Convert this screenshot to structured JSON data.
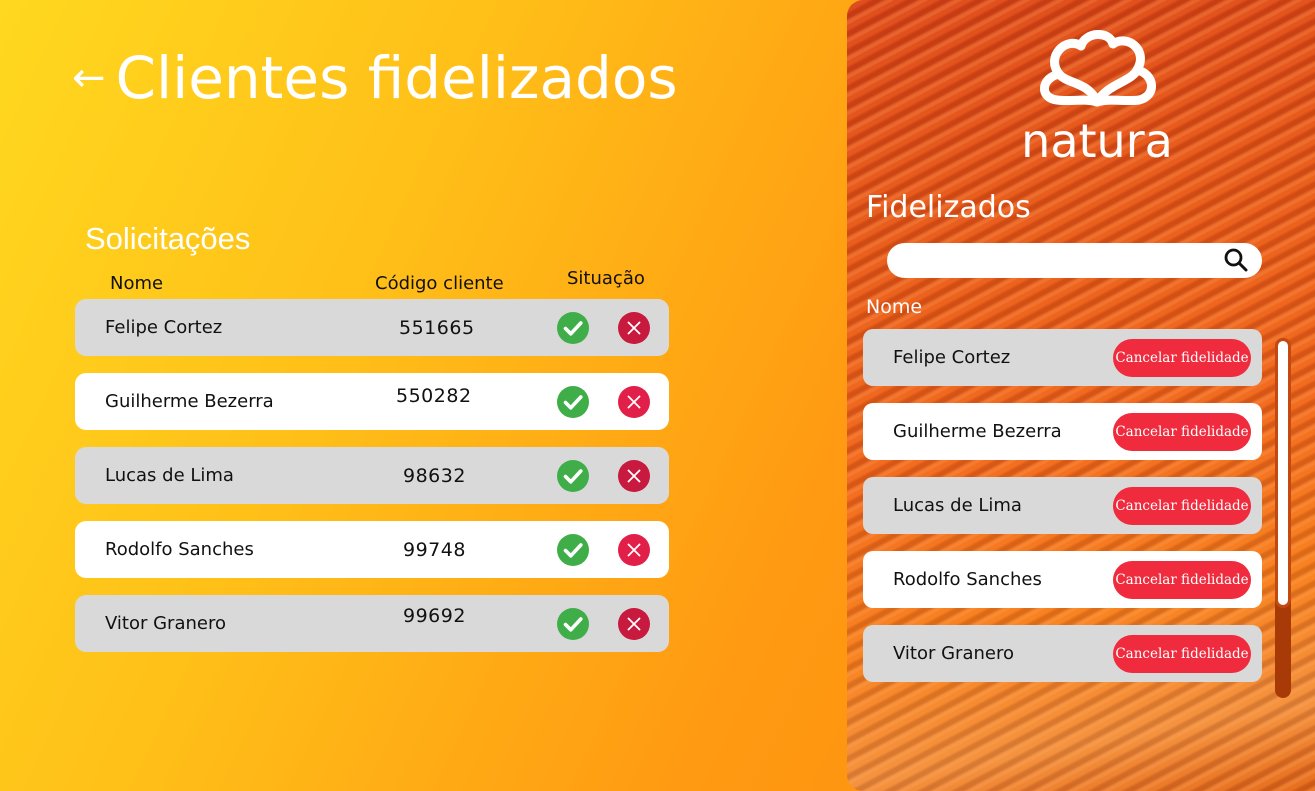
{
  "header": {
    "back_arrow": "←",
    "title": "Clientes fidelizados"
  },
  "solicitacoes": {
    "title": "Solicitações",
    "columns": {
      "nome": "Nome",
      "codigo": "Código cliente",
      "situacao": "Situação"
    },
    "rows": [
      {
        "name": "Felipe Cortez",
        "code": "551665"
      },
      {
        "name": "Guilherme Bezerra",
        "code": "550282"
      },
      {
        "name": "Lucas de Lima",
        "code": "98632"
      },
      {
        "name": "Rodolfo Sanches",
        "code": "99748"
      },
      {
        "name": "Vitor Granero",
        "code": "99692"
      }
    ]
  },
  "sidebar": {
    "brand": "natura",
    "title": "Fidelizados",
    "search": {
      "value": "",
      "placeholder": ""
    },
    "column_nome": "Nome",
    "cancel_label": "Cancelar fidelidade",
    "items": [
      {
        "name": "Felipe Cortez"
      },
      {
        "name": "Guilherme Bezerra"
      },
      {
        "name": "Lucas de Lima"
      },
      {
        "name": "Rodolfo Sanches"
      },
      {
        "name": "Vitor Granero"
      }
    ]
  },
  "colors": {
    "accept": "#3fae49",
    "reject": "#c8193f",
    "cancel": "#ef2b3d"
  },
  "icons": {
    "accept": "check-circle-icon",
    "reject": "x-circle-icon",
    "search": "search-icon",
    "back": "arrow-left-icon"
  }
}
